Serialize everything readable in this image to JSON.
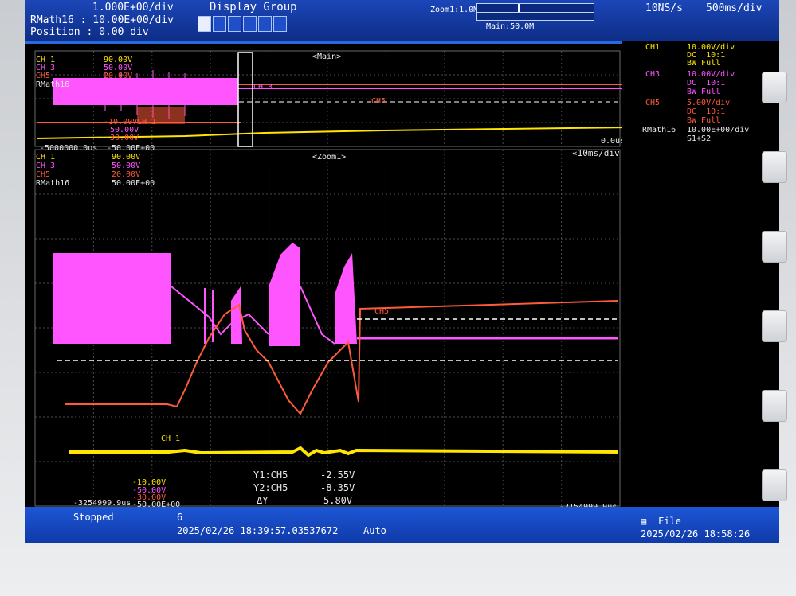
{
  "header": {
    "time_div_math": "1.000E+00/div",
    "rmath_label": "RMath16 : 10.00E+00/div",
    "position_label": "Position : 0.00 div",
    "display_group_title": "Display Group",
    "display_group_selected": "1",
    "zoom1": "Zoom1:1.0M",
    "main_record": "Main:50.0M",
    "sample_rate": "10NS/s",
    "time_per_div": "500ms/div"
  },
  "main_view": {
    "title": "<Main>",
    "ch1": "CH 1",
    "ch1_val": "90.00V",
    "ch3": "CH 3",
    "ch3_val": "50.00V",
    "ch5": "CH5",
    "ch5_val": "20.00V",
    "rmath": "RMath16",
    "ch1_low": "-10.00V",
    "ch1_low_tag": "CH 1",
    "ch3_low": "-50.00V",
    "ch5_low": "-30.00V",
    "trace_ch3": "CH 3",
    "trace_ch5": "CH5",
    "start_time": "-5000000.0us",
    "math_low": "-50.00E+00",
    "end_time": "0.0us"
  },
  "zoom_view": {
    "title": "<Zoom1>",
    "time_div": "«10ms/div",
    "ch1": "CH 1",
    "ch1_val": "90.00V",
    "ch3": "CH 3",
    "ch3_val": "50.00V",
    "ch5": "CH5",
    "ch5_val": "20.00V",
    "rmath": "RMath16",
    "rmath_val": "50.00E+00",
    "trace_ch5": "CH5",
    "trace_ch1": "CH 1",
    "low_ch1": "-10.00V",
    "low_ch3": "-50.00V",
    "low_ch5": "-30.00V",
    "low_math": "-50.00E+00",
    "start_time": "-3254999.9us",
    "end_time": "-3154999.9us"
  },
  "cursor": {
    "y1_label": "Y1:CH5",
    "y1_value": "-2.55V",
    "y2_label": "Y2:CH5",
    "y2_value": "-8.35V",
    "dy_label": "ΔY",
    "dy_value": "5.80V"
  },
  "channels": [
    {
      "name": "CH1",
      "scale": "10.00V/div",
      "coupling": "DC  10:1",
      "bw": "BW Full",
      "color": "#ffe600"
    },
    {
      "name": "CH3",
      "scale": "10.00V/div",
      "coupling": "DC  10:1",
      "bw": "BW Full",
      "color": "#ff55ff"
    },
    {
      "name": "CH5",
      "scale": "5.00V/div",
      "coupling": "DC  10:1",
      "bw": "BW Full",
      "color": "#ff5a3a"
    },
    {
      "name": "RMath16",
      "scale": "10.00E+00/div",
      "coupling": "S1+S2",
      "bw": "",
      "color": "#e8e8e8"
    }
  ],
  "status": {
    "state": "Stopped",
    "count": "6",
    "trigger_time": "2025/02/26 18:39:57.03537672",
    "mode": "Auto",
    "file_label": "File",
    "clock": "2025/02/26 18:58:26"
  },
  "colors": {
    "ch1": "#ffe600",
    "ch3": "#ff55ff",
    "ch5": "#ff5a3a",
    "grid": "#5a5a5a",
    "screen_bg": "#000000",
    "bar_blue": "#1c46b8"
  }
}
